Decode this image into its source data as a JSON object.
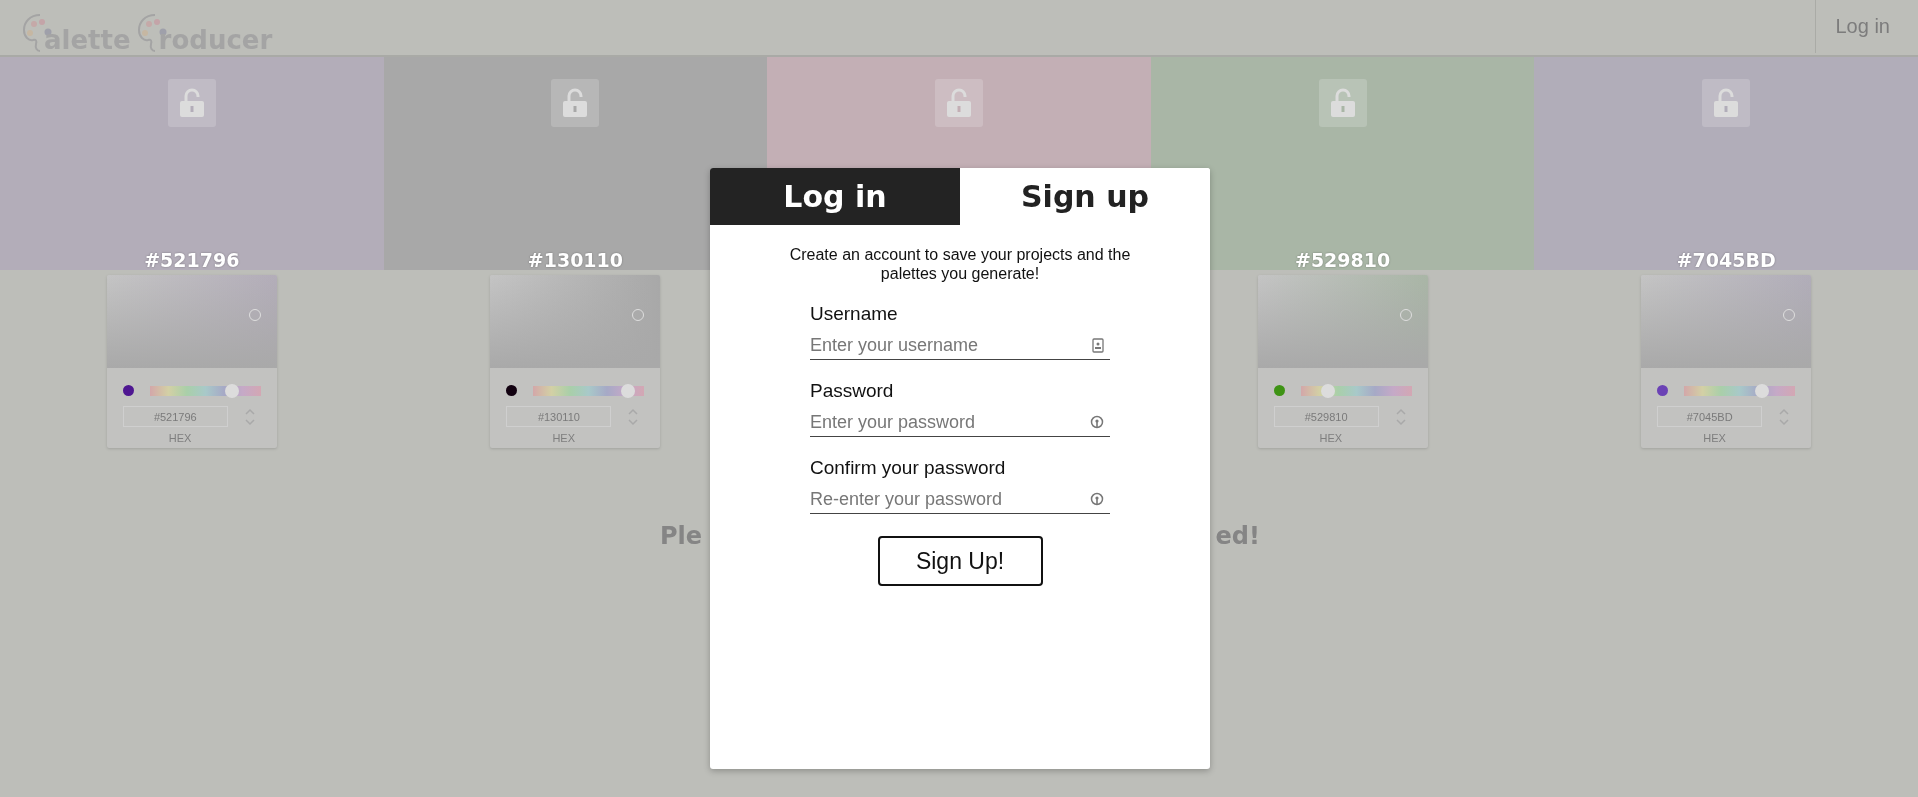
{
  "header": {
    "logo_words": [
      "alette",
      "roducer"
    ],
    "login_link": "Log in"
  },
  "swatches": [
    {
      "color": "#b3adb9",
      "hex": "#521796",
      "picker": {
        "color": "#4e1691",
        "level": 0.74,
        "hex": "#521796",
        "format": "HEX"
      }
    },
    {
      "color": "#a8a8a8",
      "hex": "#130110",
      "picker": {
        "color": "#120110",
        "level": 0.85,
        "hex": "#130110",
        "format": "HEX"
      }
    },
    {
      "color": "#c3afb5"
    },
    {
      "color": "#a9b6a6",
      "hex": "#529810",
      "picker": {
        "color": "#3e9314",
        "level": 0.25,
        "hex": "#529810",
        "format": "HEX"
      }
    },
    {
      "color": "#b1adb9",
      "hex": "#7045BD",
      "picker": {
        "color": "#6b42b5",
        "level": 0.7,
        "hex": "#7045BD",
        "format": "HEX"
      }
    }
  ],
  "message_visible_parts": [
    "Ple",
    "ed!"
  ],
  "modal": {
    "tabs": [
      {
        "label": "Log in",
        "selected": false
      },
      {
        "label": "Sign up",
        "selected": true
      }
    ],
    "description": "Create an account to save your projects and the palettes you generate!",
    "fields": [
      {
        "label": "Username",
        "placeholder": "Enter your username",
        "kind": "user"
      },
      {
        "label": "Password",
        "placeholder": "Enter your password",
        "kind": "password"
      },
      {
        "label": "Confirm your password",
        "placeholder": "Re-enter your password",
        "kind": "password"
      }
    ],
    "submit": "Sign Up!"
  }
}
